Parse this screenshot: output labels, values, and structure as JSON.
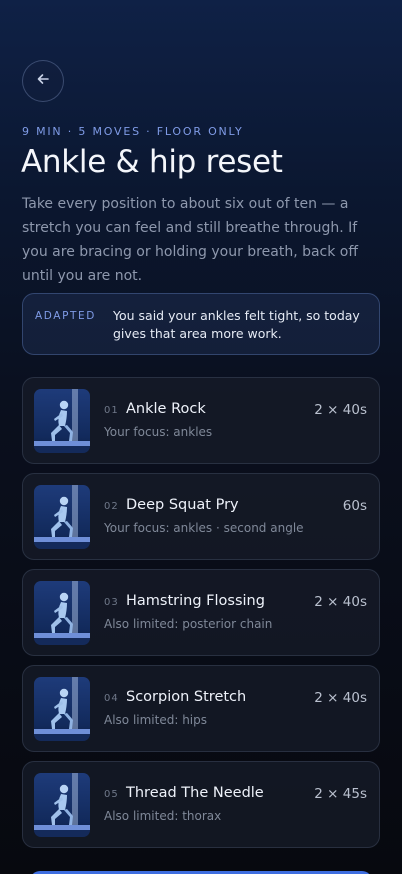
{
  "header": {
    "back_icon": "arrow-left-icon",
    "meta": "9 MIN · 5 MOVES · FLOOR ONLY",
    "title": "Ankle & hip reset",
    "intro": "Take every position to about six out of ten — a stretch you can feel and still breathe through. If you are bracing or holding your breath, back off until you are not."
  },
  "adapted": {
    "tag": "ADAPTED",
    "text": "You said your ankles felt tight, so today gives that area more work."
  },
  "moves": [
    {
      "num": "01",
      "name": "Ankle Rock",
      "dose": "2 × 40s",
      "sub": "Your focus: ankles"
    },
    {
      "num": "02",
      "name": "Deep Squat Pry",
      "dose": "60s",
      "sub": "Your focus: ankles · second angle"
    },
    {
      "num": "03",
      "name": "Hamstring Flossing",
      "dose": "2 × 40s",
      "sub": "Also limited: posterior chain"
    },
    {
      "num": "04",
      "name": "Scorpion Stretch",
      "dose": "2 × 40s",
      "sub": "Also limited: hips"
    },
    {
      "num": "05",
      "name": "Thread The Needle",
      "dose": "2 × 45s",
      "sub": "Also limited: thorax"
    }
  ],
  "colors": {
    "accent": "#7f9be6",
    "cta": "#3e6ee0"
  }
}
